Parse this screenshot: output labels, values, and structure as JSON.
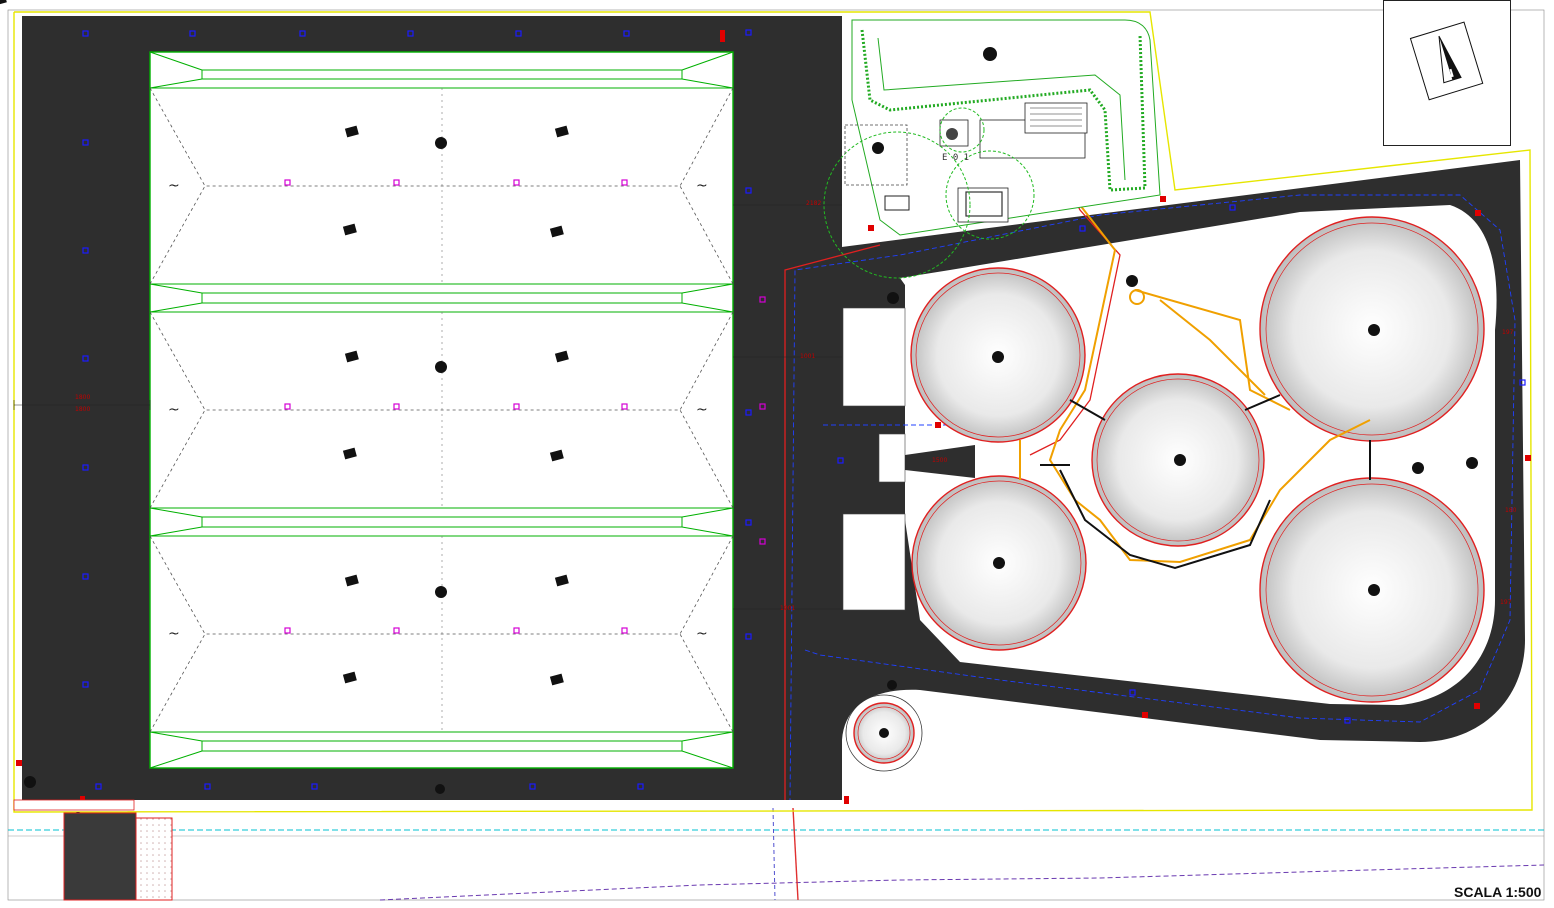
{
  "drawing": {
    "scale_label": "SCALA 1:500",
    "north_label": "N",
    "wwtp_label": "E 0 1",
    "dim_labels": [
      "1800",
      "1800",
      "2182",
      "1001",
      "1001",
      "535",
      "1500",
      "197",
      "180",
      "197",
      "182",
      "182",
      "143",
      "143"
    ]
  },
  "colors": {
    "road": "#2e2e2e",
    "pv_outline": "#00b000",
    "fence": "#e6e600",
    "digester_ring": "#e02020",
    "gas_pipe": "#f0a000",
    "electric_blue": "#1a1aff",
    "magenta_marker": "#d400d4",
    "hedge_green": "#22aa22"
  }
}
